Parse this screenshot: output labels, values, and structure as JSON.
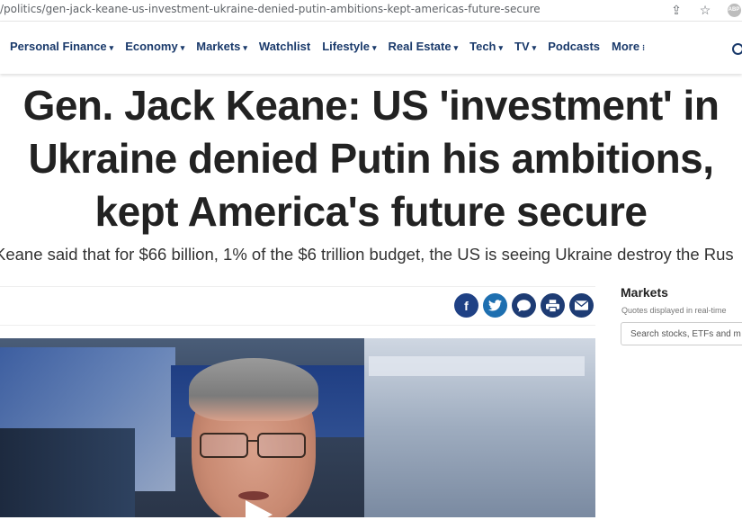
{
  "browser": {
    "url": "/politics/gen-jack-keane-us-investment-ukraine-denied-putin-ambitions-kept-americas-future-secure",
    "extension_label": "ABP"
  },
  "nav": {
    "items": [
      {
        "label": "Personal Finance",
        "caret": "▾"
      },
      {
        "label": "Economy",
        "caret": "▾"
      },
      {
        "label": "Markets",
        "caret": "▾"
      },
      {
        "label": "Watchlist",
        "caret": ""
      },
      {
        "label": "Lifestyle",
        "caret": "▾"
      },
      {
        "label": "Real Estate",
        "caret": "▾"
      },
      {
        "label": "Tech",
        "caret": "▾"
      },
      {
        "label": "TV",
        "caret": "▾"
      },
      {
        "label": "Podcasts",
        "caret": ""
      },
      {
        "label": "More",
        "caret": "⁝"
      }
    ]
  },
  "article": {
    "headline_line1": "Gen. Jack Keane: US 'investment' in",
    "headline_line2": "Ukraine denied Putin his ambitions,",
    "headline_line3": "kept America's future secure",
    "subhead": "Keane said that for $66 billion, 1% of the $6 trillion budget, the US is seeing Ukraine destroy the Rus"
  },
  "share": {
    "icons": [
      "facebook-icon",
      "twitter-icon",
      "comment-icon",
      "print-icon",
      "email-icon"
    ],
    "glyphs": {
      "facebook": "f",
      "twitter": "🐦",
      "comment": "●",
      "print": "▤",
      "email": "✉"
    }
  },
  "sidebar": {
    "title": "Markets",
    "subtitle": "Quotes displayed in real-time",
    "search_placeholder": "Search stocks, ETFs and m"
  },
  "colors": {
    "nav_text": "#1a3a6b",
    "headline": "#222222",
    "share_bg": "#1e3c74"
  }
}
